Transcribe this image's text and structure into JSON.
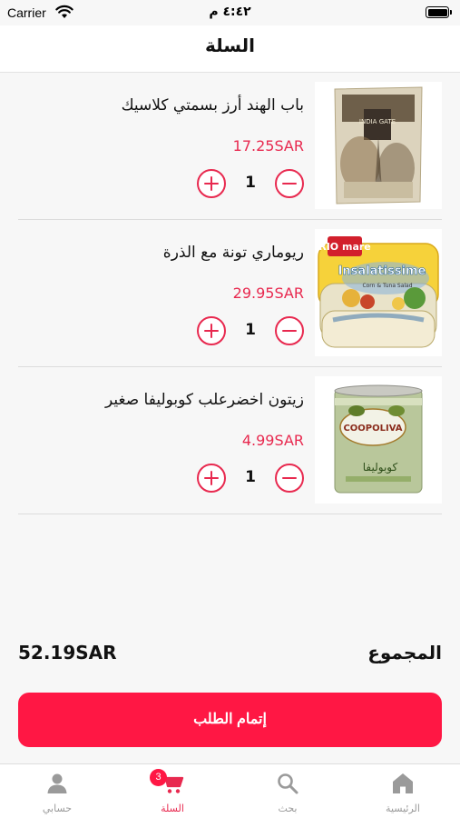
{
  "status_bar": {
    "carrier": "Carrier",
    "time": "٤:٤٢ م"
  },
  "nav": {
    "title": "السلة"
  },
  "cart": {
    "items": [
      {
        "name": "باب الهند أرز بسمتي كلاسيك",
        "price": "17.25SAR",
        "quantity": "1"
      },
      {
        "name": "ريوماري تونة مع الذرة",
        "price": "29.95SAR",
        "quantity": "1"
      },
      {
        "name": "زيتون اخضرعلب كوبوليفا صغير",
        "price": "4.99SAR",
        "quantity": "1"
      }
    ]
  },
  "product_images": {
    "rice": {
      "brand": "INDIA GATE"
    },
    "tuna": {
      "brand": "RIO mare",
      "product": "Insalatissime",
      "subtitle": "Corn & Tuna Salad"
    },
    "olives": {
      "brand": "COOPOLIVA",
      "arabic_brand": "كوبوليفا"
    }
  },
  "summary": {
    "total_label": "المجموع",
    "total_amount": "52.19SAR"
  },
  "checkout": {
    "label": "إتمام الطلب"
  },
  "tabs": [
    {
      "label": "حسابي",
      "icon": "person-icon"
    },
    {
      "label": "السلة",
      "icon": "cart-icon",
      "badge": "3"
    },
    {
      "label": "بحث",
      "icon": "search-icon"
    },
    {
      "label": "الرئيسية",
      "icon": "home-icon"
    }
  ],
  "colors": {
    "accent": "#e8294f",
    "button": "#ff1744",
    "inactive": "#9a9a9a",
    "background": "#f7f7f7"
  }
}
